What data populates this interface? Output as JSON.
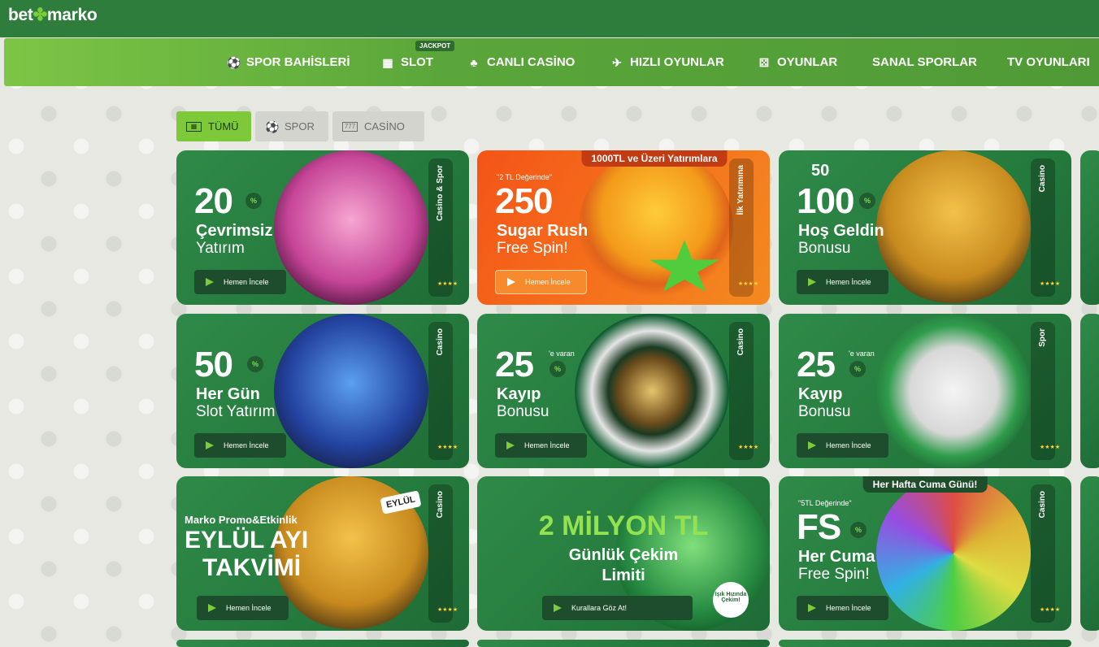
{
  "brand": {
    "logo_left": "bet",
    "logo_mark": "✤",
    "logo_right": "marko"
  },
  "nav": {
    "items": [
      {
        "label": "SPOR BAHİSLERİ",
        "icon": "soccer-ball-icon"
      },
      {
        "label": "SLOT",
        "icon": "slot-machine-icon",
        "badge": "JACKPOT"
      },
      {
        "label": "CANLI CASİNO",
        "icon": "dealer-icon"
      },
      {
        "label": "HIZLI OYUNLAR",
        "icon": "plane-icon"
      },
      {
        "label": "OYUNLAR",
        "icon": "dice-icon"
      },
      {
        "label": "SANAL SPORLAR",
        "icon": ""
      },
      {
        "label": "TV OYUNLARI",
        "icon": ""
      }
    ]
  },
  "filters": [
    {
      "label": "TÜMÜ",
      "active": true
    },
    {
      "label": "SPOR",
      "active": false
    },
    {
      "label": "CASİNO",
      "active": false
    }
  ],
  "cards": [
    {
      "side": "Casino & Spor",
      "big": "20",
      "pct": "%",
      "line1": "Çevrimsiz",
      "line2": "Yatırım",
      "cta": "Hemen İncele"
    },
    {
      "side": "İlk Yatırımına",
      "ribbon": "1000TL ve Üzeri Yatırımlara",
      "pre": "\"2 TL Değerinde\"",
      "big": "250",
      "line1": "Sugar Rush",
      "line2": "Free Spin!",
      "cta": "Hemen İncele"
    },
    {
      "side": "Casino",
      "small": "50",
      "big": "100",
      "pct": "%",
      "line1": "Hoş Geldin",
      "line2": "Bonusu",
      "cta": "Hemen İncele"
    },
    {
      "side": "Casino",
      "big": "50",
      "pct": "%",
      "line1": "Her Gün",
      "line2": "Slot Yatırım",
      "cta": "Hemen İncele"
    },
    {
      "side": "Casino",
      "big": "25",
      "pct": "%",
      "sup": "'e varan",
      "line1": "Kayıp",
      "line2": "Bonusu",
      "cta": "Hemen İncele"
    },
    {
      "side": "Spor",
      "big": "25",
      "pct": "%",
      "sup": "'e varan",
      "line1": "Kayıp",
      "line2": "Bonusu",
      "cta": "Hemen İncele"
    },
    {
      "side": "Casino",
      "line0": "Marko Promo&Etkinlik",
      "line1": "EYLÜL AYI",
      "line2": "TAKVİMİ",
      "calendar": "EYLÜL",
      "cta": "Hemen İncele"
    },
    {
      "big": "2 MİLYON TL",
      "line1": "Günlük Çekim",
      "line2": "Limiti",
      "tag": "Işık Hızında Çekim!",
      "cta": "Kurallara Göz At!"
    },
    {
      "side": "Casino",
      "ribbon": "Her Hafta Cuma Günü!",
      "pre": "\"5TL Değerinde\"",
      "big": "FS",
      "pct": "%",
      "line1": "Her Cuma",
      "line2": "Free Spin!",
      "cta": "Hemen İncele"
    }
  ],
  "colors": {
    "topbar": "#2f7d3c",
    "nav_start": "#7cc545",
    "accent": "#7dc93a",
    "card": "#247a3d",
    "orange": "#f5701c"
  }
}
